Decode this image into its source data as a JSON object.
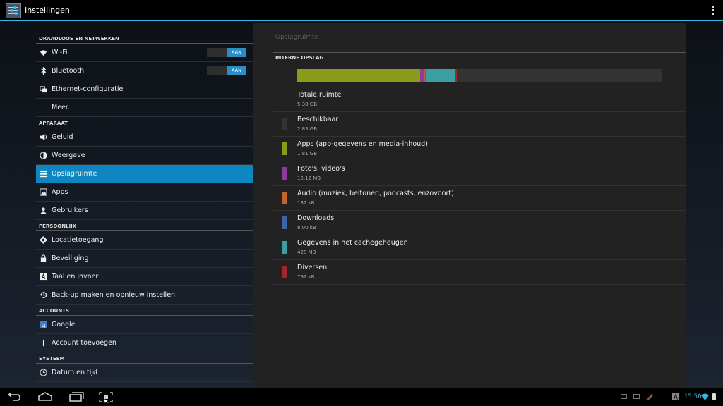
{
  "app": {
    "title": "Instellingen",
    "icon": "settings-app-icon"
  },
  "sidebar": {
    "categories": {
      "wireless": "DRAADLOOS EN NETWERKEN",
      "device": "APPARAAT",
      "personal": "PERSOONLIJK",
      "accounts": "ACCOUNTS",
      "system": "SYSTEEM"
    },
    "items": {
      "wifi": "Wi-Fi",
      "bluetooth": "Bluetooth",
      "ethernet": "Ethernet-configuratie",
      "more": "Meer...",
      "sound": "Geluid",
      "display": "Weergave",
      "storage": "Opslagruimte",
      "apps": "Apps",
      "users": "Gebruikers",
      "location": "Locatietoegang",
      "security": "Beveiliging",
      "language": "Taal en invoer",
      "backup": "Back-up maken en opnieuw instellen",
      "google": "Google",
      "add_account": "Account toevoegen",
      "datetime": "Datum en tijd"
    },
    "toggles": {
      "wifi": "AAN",
      "bluetooth": "AAN"
    }
  },
  "storage": {
    "title": "Opslagruimte",
    "header": "INTERNE OPSLAG",
    "total": {
      "label": "Totale ruimte",
      "value": "5,38 GB"
    },
    "rows": [
      {
        "label": "Beschikbaar",
        "value": "2,83 GB",
        "color": "#333333"
      },
      {
        "label": "Apps (app-gegevens en media-inhoud)",
        "value": "1,81 GB",
        "color": "#8a9a1b"
      },
      {
        "label": "Foto's, video's",
        "value": "15,12 MB",
        "color": "#8e3aa0"
      },
      {
        "label": "Audio (muziek, beltonen, podcasts, enzovoort)",
        "value": "132 kB",
        "color": "#c0652c"
      },
      {
        "label": "Downloads",
        "value": "8,00 kB",
        "color": "#3f62a8"
      },
      {
        "label": "Gegevens in het cachegeheugen",
        "value": "428 MB",
        "color": "#3a9ea2"
      },
      {
        "label": "Diversen",
        "value": "792 kB",
        "color": "#a0282a"
      }
    ]
  },
  "statusbar": {
    "time": "15:56"
  },
  "colors": {
    "accent": "#33b5e5",
    "selected": "#0e86c2"
  }
}
